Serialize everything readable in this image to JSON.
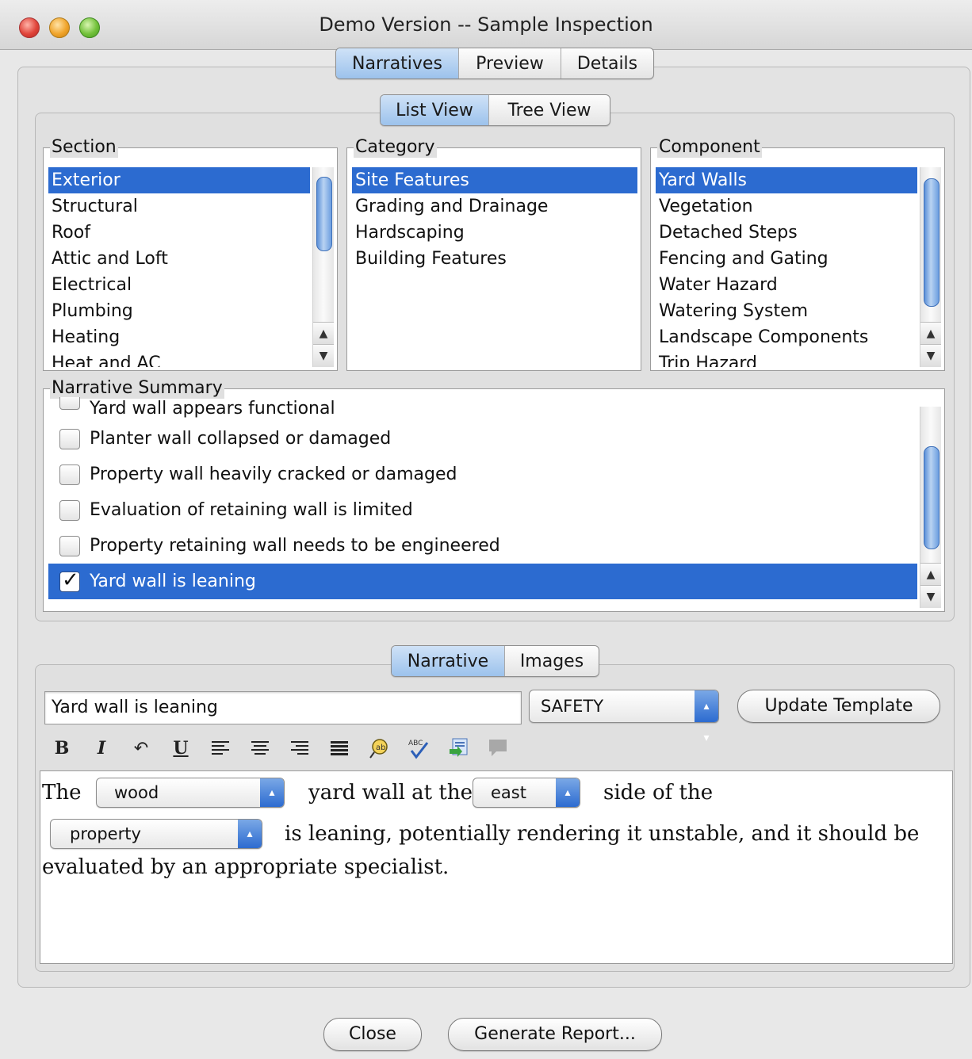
{
  "window": {
    "title": "Demo Version -- Sample Inspection"
  },
  "main_tabs": [
    {
      "label": "Narratives",
      "active": true
    },
    {
      "label": "Preview",
      "active": false
    },
    {
      "label": "Details",
      "active": false
    }
  ],
  "view_tabs": [
    {
      "label": "List View",
      "active": true
    },
    {
      "label": "Tree View",
      "active": false
    }
  ],
  "section": {
    "title": "Section",
    "items": [
      "Exterior",
      "Structural",
      "Roof",
      "Attic and Loft",
      "Electrical",
      "Plumbing",
      "Heating",
      "Heat and AC"
    ],
    "selected": "Exterior"
  },
  "category": {
    "title": "Category",
    "items": [
      "Site Features",
      "Grading and Drainage",
      "Hardscaping",
      "Building Features"
    ],
    "selected": "Site Features"
  },
  "component": {
    "title": "Component",
    "items": [
      "Yard Walls",
      "Vegetation",
      "Detached Steps",
      "Fencing and Gating",
      "Water Hazard",
      "Watering System",
      "Landscape Components",
      "Trip Hazard"
    ],
    "selected": "Yard Walls"
  },
  "narrative_summary": {
    "title": "Narrative Summary",
    "items": [
      {
        "label": "Yard wall appears functional",
        "checked": false,
        "selected": false
      },
      {
        "label": "Planter wall collapsed or damaged",
        "checked": false,
        "selected": false
      },
      {
        "label": "Property wall heavily cracked or damaged",
        "checked": false,
        "selected": false
      },
      {
        "label": "Evaluation of retaining wall is limited",
        "checked": false,
        "selected": false
      },
      {
        "label": "Property retaining wall needs to be engineered",
        "checked": false,
        "selected": false
      },
      {
        "label": "Yard wall is leaning",
        "checked": true,
        "selected": true
      }
    ]
  },
  "editor_tabs": [
    {
      "label": "Narrative",
      "active": true
    },
    {
      "label": "Images",
      "active": false
    }
  ],
  "editor": {
    "title_value": "Yard wall is leaning",
    "severity": "SAFETY",
    "update_button": "Update Template",
    "toolbar_icons": [
      "bold-icon",
      "italic-icon",
      "undo-icon",
      "underline-icon",
      "align-left-icon",
      "align-center-icon",
      "align-right-icon",
      "justify-icon",
      "insert-phrase-icon",
      "spellcheck-icon",
      "import-icon",
      "comment-icon"
    ],
    "toolbar_glyphs": {
      "bold": "B",
      "italic": "I",
      "undo": "↶",
      "underline": "U"
    },
    "text": {
      "part1": "The",
      "material": "wood",
      "part2": "yard wall at the",
      "direction": "east",
      "part3": "side of the",
      "location": "property",
      "part4": "is leaning, potentially rendering it unstable, and it should be",
      "part5": "evaluated by an appropriate specialist."
    }
  },
  "footer": {
    "close": "Close",
    "generate": "Generate Report..."
  },
  "colors": {
    "selection": "#2c6bd0",
    "accent_blue": "#9cc2ec"
  }
}
